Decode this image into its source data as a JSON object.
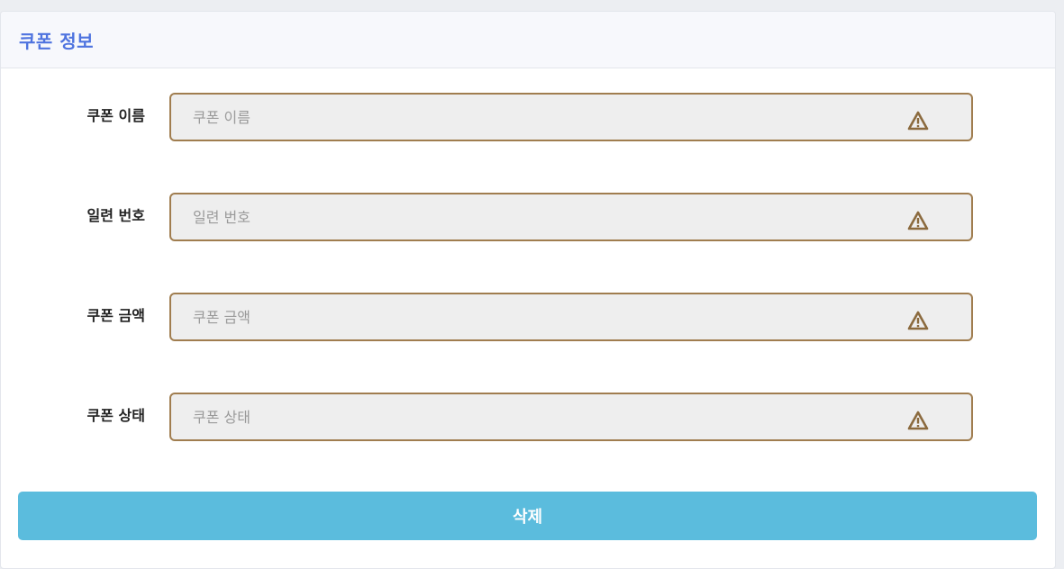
{
  "card": {
    "title": "쿠폰 정보"
  },
  "fields": [
    {
      "label": "쿠폰 이름",
      "placeholder": "쿠폰 이름",
      "value": ""
    },
    {
      "label": "일련 번호",
      "placeholder": "일련 번호",
      "value": ""
    },
    {
      "label": "쿠폰 금액",
      "placeholder": "쿠폰 금액",
      "value": ""
    },
    {
      "label": "쿠폰 상태",
      "placeholder": "쿠폰 상태",
      "value": ""
    }
  ],
  "actions": {
    "delete_label": "삭제"
  },
  "colors": {
    "title": "#4e73df",
    "input_border": "#a07d4f",
    "warning_icon": "#8b6a3e",
    "delete_button": "#5bbcdd"
  },
  "icons": {
    "field_status": "warning-triangle-icon"
  }
}
